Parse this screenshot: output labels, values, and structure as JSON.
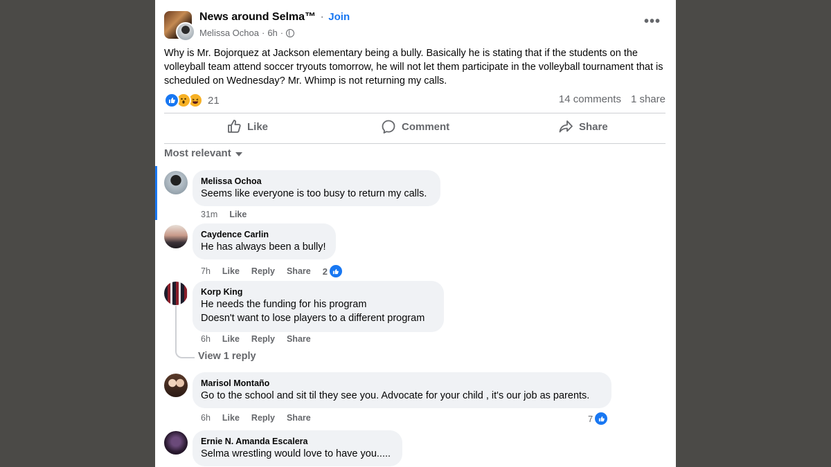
{
  "post": {
    "group_name": "News around Selma™",
    "dot": "·",
    "join_label": "Join",
    "author": "Melissa Ochoa",
    "time": "6h",
    "more_label": "•••",
    "body": "Why is Mr.  Bojorquez at Jackson elementary being a bully.  Basically he is stating that if the students on the volleyball  team attend soccer tryouts tomorrow, he will not let them participate in the volleyball tournament that is scheduled on Wednesday? Mr. Whimp is not returning my calls.",
    "reaction_icons": [
      "like-icon",
      "wow-icon",
      "haha-icon"
    ],
    "reaction_count": "21",
    "comments_count": "14 comments",
    "shares_count": "1 share"
  },
  "actions": {
    "like": "Like",
    "comment": "Comment",
    "share": "Share"
  },
  "sort_label": "Most relevant",
  "comments": [
    {
      "name": "Melissa Ochoa",
      "lines": [
        "Seems like everyone is too busy to return my calls."
      ],
      "time": "31m",
      "like": "Like"
    },
    {
      "name": "Caydence Carlin",
      "lines": [
        "He has always been a bully!"
      ],
      "time": "7h",
      "like": "Like",
      "reply": "Reply",
      "share": "Share",
      "reactions": "2"
    },
    {
      "name": "Korp King",
      "lines": [
        "He needs the funding for his program",
        "Doesn't want to lose players to a different program"
      ],
      "time": "6h",
      "like": "Like",
      "reply": "Reply",
      "share": "Share",
      "view_replies": "View 1 reply"
    },
    {
      "name": "Marisol Montaño",
      "lines": [
        "Go to the school and sit til they see you. Advocate for your child , it's our job as parents."
      ],
      "time": "6h",
      "like": "Like",
      "reply": "Reply",
      "share": "Share",
      "reactions": "7"
    },
    {
      "name": "Ernie N. Amanda Escalera",
      "lines": [
        "Selma wrestling would love to have you....."
      ]
    }
  ],
  "colors": {
    "accent": "#1877f2",
    "secondary_text": "#65676b",
    "bubble": "#f0f2f5",
    "backdrop": "#4b4a47"
  }
}
